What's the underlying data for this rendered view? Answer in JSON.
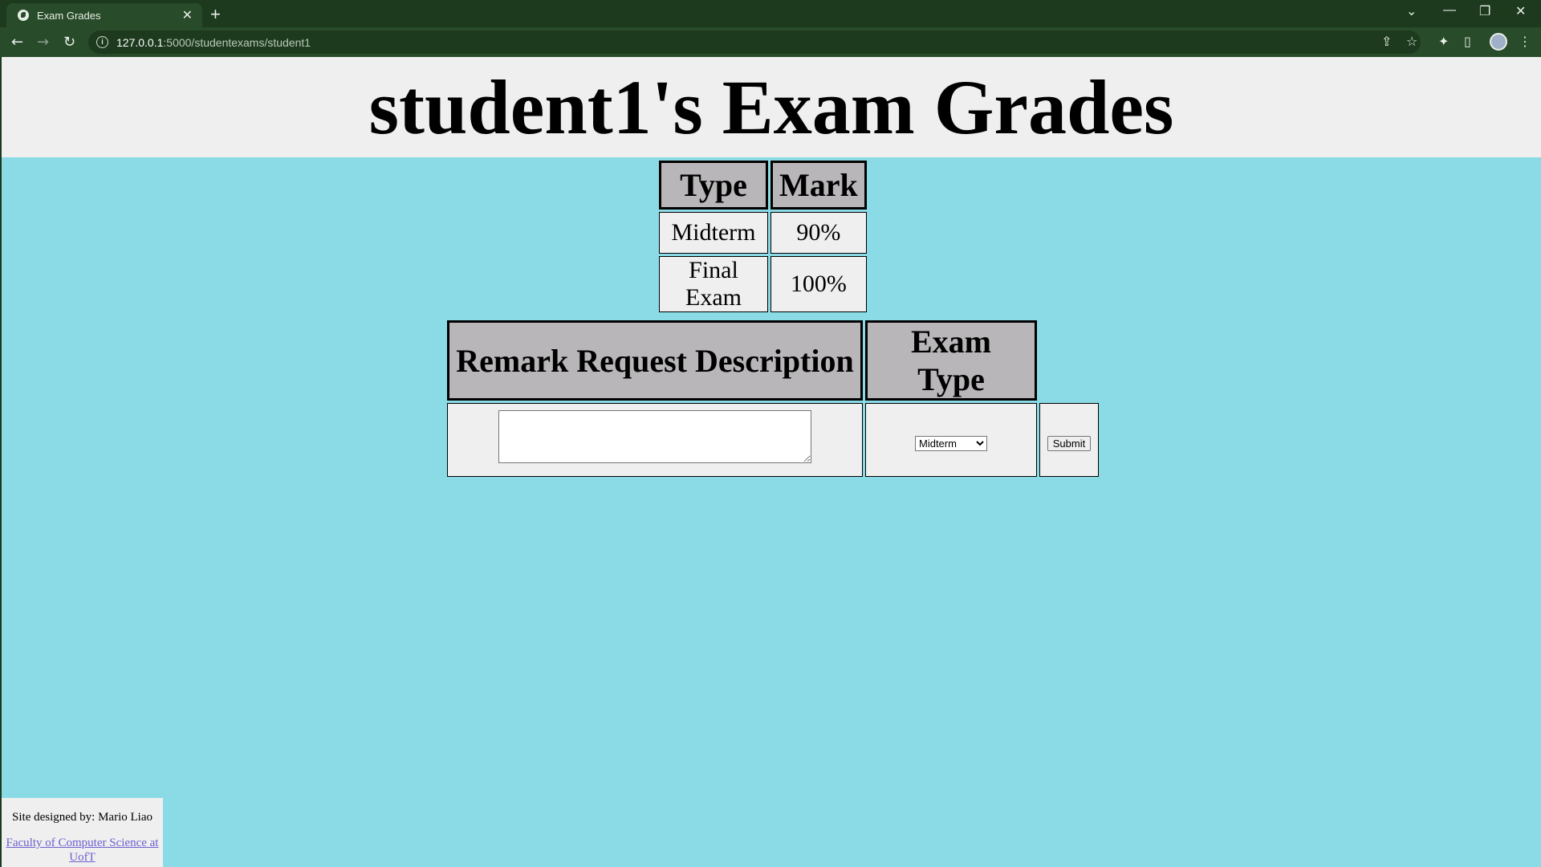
{
  "browser": {
    "tab_title": "Exam Grades",
    "url_host": "127.0.0.1",
    "url_path": ":5000/studentexams/student1"
  },
  "page": {
    "title": "student1's Exam Grades"
  },
  "grades_table": {
    "headers": [
      "Type",
      "Mark"
    ],
    "rows": [
      {
        "type": "Midterm",
        "mark": "90%"
      },
      {
        "type": "Final Exam",
        "mark": "100%"
      }
    ]
  },
  "remark_form": {
    "headers": [
      "Remark Request Description",
      "Exam Type"
    ],
    "description_value": "",
    "exam_type_selected": "Midterm",
    "submit_label": "Submit"
  },
  "footer": {
    "designer_text": "Site designed by: Mario Liao",
    "link_text": "Faculty of Computer Science at UofT"
  }
}
